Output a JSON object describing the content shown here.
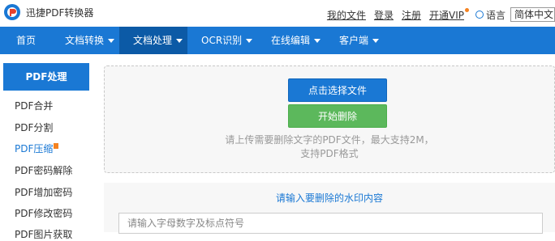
{
  "header": {
    "brand": "迅捷PDF转换器",
    "links": [
      {
        "label": "我的文件"
      },
      {
        "label": "登录"
      },
      {
        "label": "注册"
      },
      {
        "label": "开通VIP"
      }
    ],
    "language_label": "语言",
    "language_value": "简体中文"
  },
  "nav": {
    "items": [
      {
        "label": "首页"
      },
      {
        "label": "文档转换"
      },
      {
        "label": "文档处理"
      },
      {
        "label": "OCR识别"
      },
      {
        "label": "在线编辑"
      },
      {
        "label": "客户端"
      }
    ]
  },
  "sidebar": {
    "title": "PDF处理",
    "items": [
      {
        "label": "PDF合并"
      },
      {
        "label": "PDF分割"
      },
      {
        "label": "PDF压缩"
      },
      {
        "label": "PDF密码解除"
      },
      {
        "label": "PDF增加密码"
      },
      {
        "label": "PDF修改密码"
      },
      {
        "label": "PDF图片获取"
      }
    ]
  },
  "main": {
    "select_button": "点击选择文件",
    "start_button": "开始删除",
    "hint_line1": "请上传需要删除文字的PDF文件，最大支持2M，",
    "hint_line2": "支持PDF格式",
    "watermark_title": "请输入要删除的水印内容",
    "watermark_placeholder": "请输入字母数字及标点符号"
  },
  "colors": {
    "primary": "#1a78d4",
    "nav_active": "#0c5aa6",
    "success": "#5cb85c",
    "accent": "#f58220"
  }
}
